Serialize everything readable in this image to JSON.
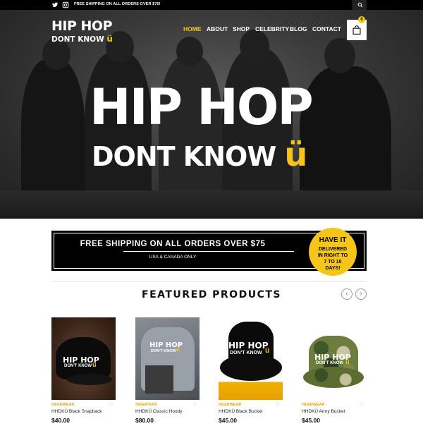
{
  "topbar": {
    "shipping_text": "FREE SHIPPING ON ALL ORDERS OVER $75!",
    "social_icons": [
      "twitter-icon",
      "instagram-icon"
    ],
    "search_icon": "search-icon"
  },
  "brand": {
    "logo_line1": "HIP HOP",
    "logo_line2": "DONT KNOW",
    "logo_u": "ü",
    "accent_color": "#f5c518"
  },
  "nav": {
    "items": [
      "HOME",
      "ABOUT",
      "SHOP",
      "CELEBRITY",
      "BLOG",
      "CONTACT"
    ],
    "active": "HOME"
  },
  "cart": {
    "count": "0",
    "icon": "shopping-bag-icon"
  },
  "hero": {
    "line1": "HIP HOP",
    "line2": "DONT KNOW",
    "u": "ü"
  },
  "shipping_banner": {
    "title": "FREE SHIPPING ON ALL ORDERS OVER $75",
    "subtitle": "USA & CANADA ONLY",
    "badge_line1": "HAVE IT",
    "badge_line2": "DELIVERED IN RIGHT TO",
    "badge_line3": "7 TO 10 DAYS!"
  },
  "featured": {
    "title": "FEATURED PRODUCTS",
    "prev_icon": "chevron-left-icon",
    "next_icon": "chevron-right-icon",
    "products": [
      {
        "category": "HEADWEAR",
        "name": "HHDKÜ Black Snapback",
        "price": "$40.00",
        "image_text1": "HIP HOP",
        "image_text2": "DON'T KNOW",
        "image_u": "ü"
      },
      {
        "category": "SWEATERS",
        "name": "HHDKÜ Classic Hoody",
        "price": "$80.00",
        "image_text1": "HIP HOP",
        "image_text2": "DON'T KNOW",
        "image_u": "ü"
      },
      {
        "category": "HEADWEAR",
        "name": "HHDKÜ Black Bucket",
        "price": "$45.00",
        "image_text1": "HIP HOP",
        "image_text2": "DON'T KNOW",
        "image_u": "ü"
      },
      {
        "category": "HEADWEAR",
        "name": "HHDKÜ Army Bucket",
        "price": "$45.00",
        "image_text1": "HIP HOP",
        "image_text2": "DON'T KNOW",
        "image_u": "ü"
      }
    ]
  }
}
